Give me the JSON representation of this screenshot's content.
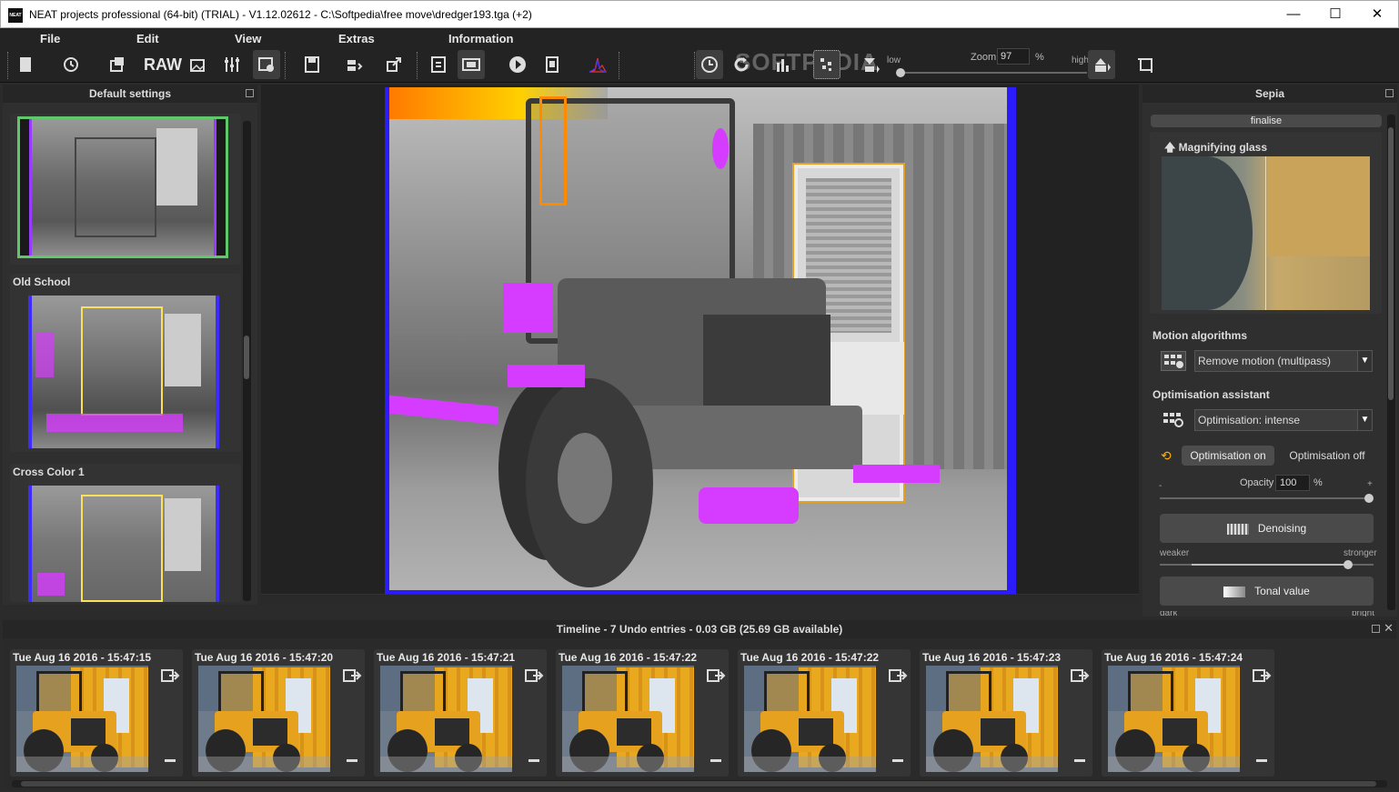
{
  "window": {
    "title": "NEAT projects professional (64-bit) (TRIAL) - V1.12.02612 - C:\\Softpedia\\free move\\dredger193.tga (+2)",
    "app_icon_text": "NEAT",
    "minimize": "—",
    "maximize": "☐",
    "close": "✕"
  },
  "menu": {
    "file": "File",
    "edit": "Edit",
    "view": "View",
    "extras": "Extras",
    "information": "Information"
  },
  "toolbar": {
    "raw_label": "RAW",
    "zoom_label": "Zoom",
    "zoom_value": "97",
    "zoom_unit": "%",
    "low_label": "low",
    "high_label": "high",
    "watermark": "SOFTPEDIA",
    "zoom_level": 0.0
  },
  "left_panel": {
    "title": "Default settings",
    "presets": [
      {
        "label": ""
      },
      {
        "label": "Old School"
      },
      {
        "label": "Cross Color 1"
      }
    ]
  },
  "right_panel": {
    "title": "Sepia",
    "finalise_label": "finalise",
    "magnifier_title": "Magnifying glass",
    "motion_title": "Motion algorithms",
    "motion_value": "Remove motion (multipass)",
    "optim_title": "Optimisation assistant",
    "optim_value": "Optimisation: intense",
    "optim_on": "Optimisation on",
    "optim_off": "Optimisation off",
    "opacity_label": "Opacity",
    "opacity_value": "100",
    "opacity_unit": "%",
    "minus": "-",
    "plus": "+",
    "denoise_label": "Denoising",
    "weaker_label": "weaker",
    "stronger_label": "stronger",
    "tonal_label": "Tonal value",
    "dark_label": "dark",
    "bright_label": "bright",
    "opacity_level": 1.0,
    "denoise_level": 0.88
  },
  "timeline": {
    "title": "Timeline - 7 Undo entries - 0.03 GB (25.69 GB available)",
    "entries": [
      {
        "date": "Tue Aug 16 2016 - 15:47:15"
      },
      {
        "date": "Tue Aug 16 2016 - 15:47:20"
      },
      {
        "date": "Tue Aug 16 2016 - 15:47:21"
      },
      {
        "date": "Tue Aug 16 2016 - 15:47:22"
      },
      {
        "date": "Tue Aug 16 2016 - 15:47:22"
      },
      {
        "date": "Tue Aug 16 2016 - 15:47:23"
      },
      {
        "date": "Tue Aug 16 2016 - 15:47:24"
      }
    ]
  },
  "colors": {
    "panel": "#2f2f2f",
    "accent_green": "#5fc86a",
    "highlight_magenta": "#d63cff",
    "frame_blue": "#2b1cff",
    "forklift_yellow": "#e6a21e"
  }
}
